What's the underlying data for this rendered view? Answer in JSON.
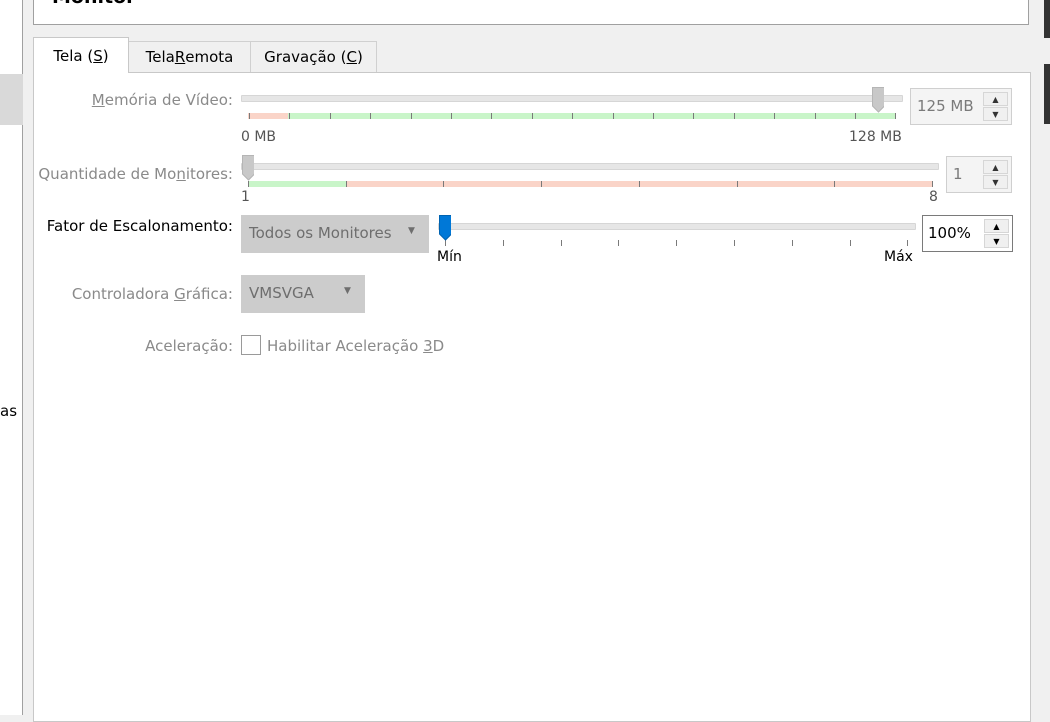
{
  "header": {
    "title": "Monitor"
  },
  "sidebar": {
    "partial_text": "as"
  },
  "tabs": [
    {
      "label_pre": "Tela (",
      "mnemonic": "S",
      "label_post": ")"
    },
    {
      "label_pre": "Tela ",
      "mnemonic": "R",
      "label_post": "emota"
    },
    {
      "label_pre": "Gravação (",
      "mnemonic": "C",
      "label_post": ")"
    }
  ],
  "video_memory": {
    "label_pre": "",
    "mnemonic": "M",
    "label_post": "emória de Vídeo:",
    "min_label": "0 MB",
    "max_label": "128 MB",
    "value_text": "125 MB",
    "value_fraction": 0.98
  },
  "monitors": {
    "label_pre": "Quantidade de Mo",
    "mnemonic": "n",
    "label_post": "itores:",
    "min_label": "1",
    "max_label": "8",
    "value_text": "1",
    "value_fraction": 0.0
  },
  "scaling": {
    "label": "Fator de Escalonamento:",
    "combo_value": "Todos os Monitores",
    "min_label": "Mín",
    "max_label": "Máx",
    "value_text": "100%",
    "value_fraction": 0.0
  },
  "graphics_controller": {
    "label_pre": "Controladora ",
    "mnemonic": "G",
    "label_post": "ráfica:",
    "combo_value": "VMSVGA"
  },
  "acceleration": {
    "label": "Aceleração:",
    "checkbox_pre": "Habilitar Aceleração ",
    "mnemonic": "3",
    "checkbox_post": "D",
    "checked": false
  },
  "colors": {
    "accent": "#0078d7",
    "disabled_text": "#8a8a8a",
    "zone_green": "#c9f5c9",
    "zone_red": "#fad4c8"
  }
}
